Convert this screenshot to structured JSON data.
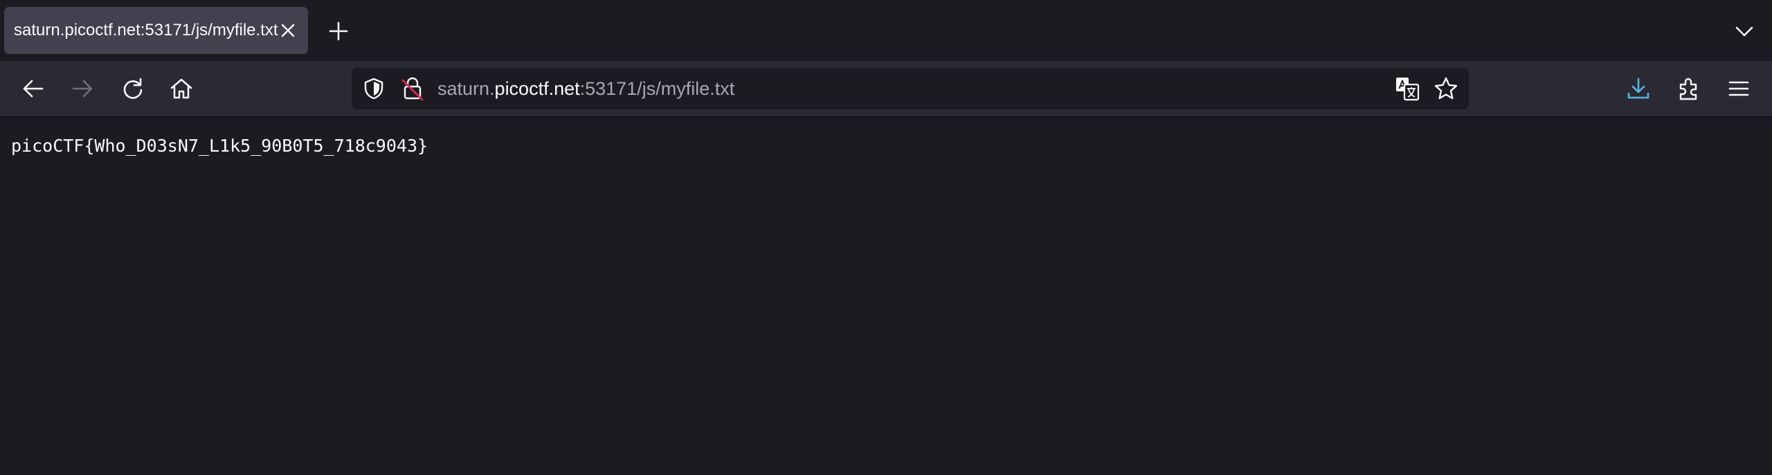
{
  "tab": {
    "title": "saturn.picoctf.net:53171/js/myfile.txt"
  },
  "toolbar": {
    "icons": [
      "back-icon",
      "forward-icon",
      "reload-icon",
      "home-icon",
      "tracking-shield-icon",
      "insecure-lock-icon",
      "translate-icon",
      "bookmark-star-icon",
      "downloads-icon",
      "extensions-icon",
      "menu-icon"
    ]
  },
  "urlbar": {
    "prefix": "saturn.",
    "host": "picoctf.net",
    "suffix": ":53171/js/myfile.txt"
  },
  "page": {
    "text": "picoCTF{Who_D03sN7_L1k5_90B0T5_718c9043}"
  },
  "colors": {
    "background": "#1c1b22",
    "toolbar": "#2b2a33",
    "active_tab": "#42414d",
    "download_accent": "#54b8e8",
    "insecure_red": "#e22850"
  }
}
